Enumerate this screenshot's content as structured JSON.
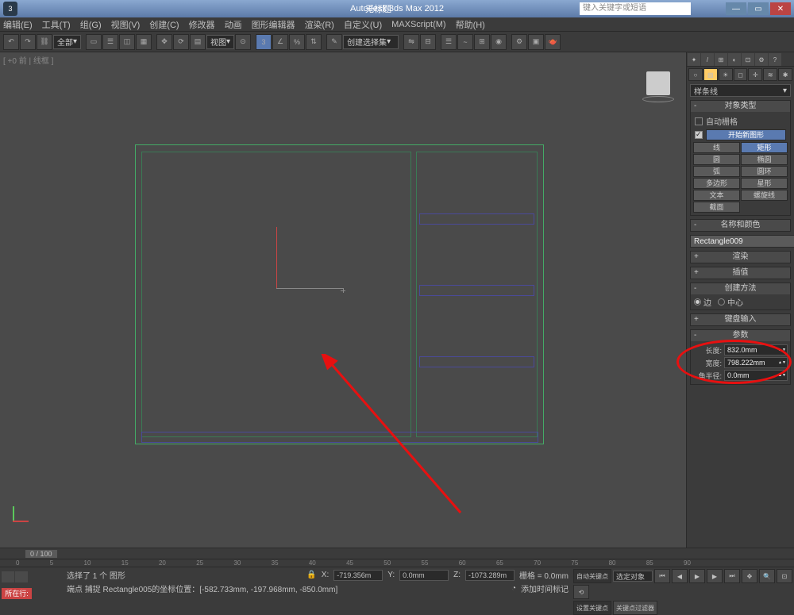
{
  "titlebar": {
    "app_title": "Autodesk 3ds Max  2012",
    "doc_title": "无标题",
    "search_placeholder": "键入关键字或短语"
  },
  "menu": {
    "edit": "编辑(E)",
    "tools": "工具(T)",
    "group": "组(G)",
    "views": "视图(V)",
    "create": "创建(C)",
    "modifiers": "修改器",
    "animation": "动画",
    "graph": "图形编辑器",
    "rendering": "渲染(R)",
    "customize": "自定义(U)",
    "maxscript": "MAXScript(M)",
    "help": "帮助(H)"
  },
  "toolbar": {
    "layer_all": "全部",
    "view_label": "视图",
    "selector": "创建选择集"
  },
  "viewport": {
    "label": "[ +0 前 | 线框 ]",
    "viewcube": ""
  },
  "cmd": {
    "category": "样条线",
    "rollouts": {
      "obj_type": "对象类型",
      "name_color": "名称和颜色",
      "render": "渲染",
      "interp": "插值",
      "create_method": "创建方法",
      "keyboard": "键盘输入",
      "params": "参数"
    },
    "auto_grid": "自动栅格",
    "start_new": "开始新图形",
    "obj_types": {
      "line": "线",
      "rectangle": "矩形",
      "circle": "圆",
      "ellipse": "椭圆",
      "arc": "弧",
      "donut": "圆环",
      "ngon": "多边形",
      "star": "星形",
      "text": "文本",
      "helix": "螺旋线",
      "section": "截面"
    },
    "object_name": "Rectangle009",
    "method": {
      "edge": "边",
      "center": "中心"
    },
    "params": {
      "length_label": "长度:",
      "length_value": "832.0mm",
      "width_label": "宽度:",
      "width_value": "798.222mm",
      "radius_label": "角半径:",
      "radius_value": "0.0mm"
    }
  },
  "timeslider": {
    "pos": "0 / 100"
  },
  "timeline": {
    "ticks": [
      "0",
      "5",
      "10",
      "15",
      "20",
      "25",
      "30",
      "35",
      "40",
      "45",
      "50",
      "55",
      "60",
      "65",
      "70",
      "75",
      "80",
      "85",
      "90"
    ]
  },
  "status": {
    "anim_btn": "所在行:",
    "selection": "选择了 1 个 图形",
    "snap_line": "端点 捕捉 Rectangle005的坐标位置：[-582.733mm, -197.968mm, -850.0mm]",
    "x_label": "X:",
    "x_val": "-719.356m",
    "y_label": "Y:",
    "y_val": "0.0mm",
    "z_label": "Z:",
    "z_val": "-1073.289m",
    "grid": "栅格 = 0.0mm",
    "add_time": "添加时间标记",
    "auto_key": "自动关键点",
    "set_key": "设置关键点",
    "sel_obj": "选定对象",
    "key_filter": "关键点过滤器"
  }
}
